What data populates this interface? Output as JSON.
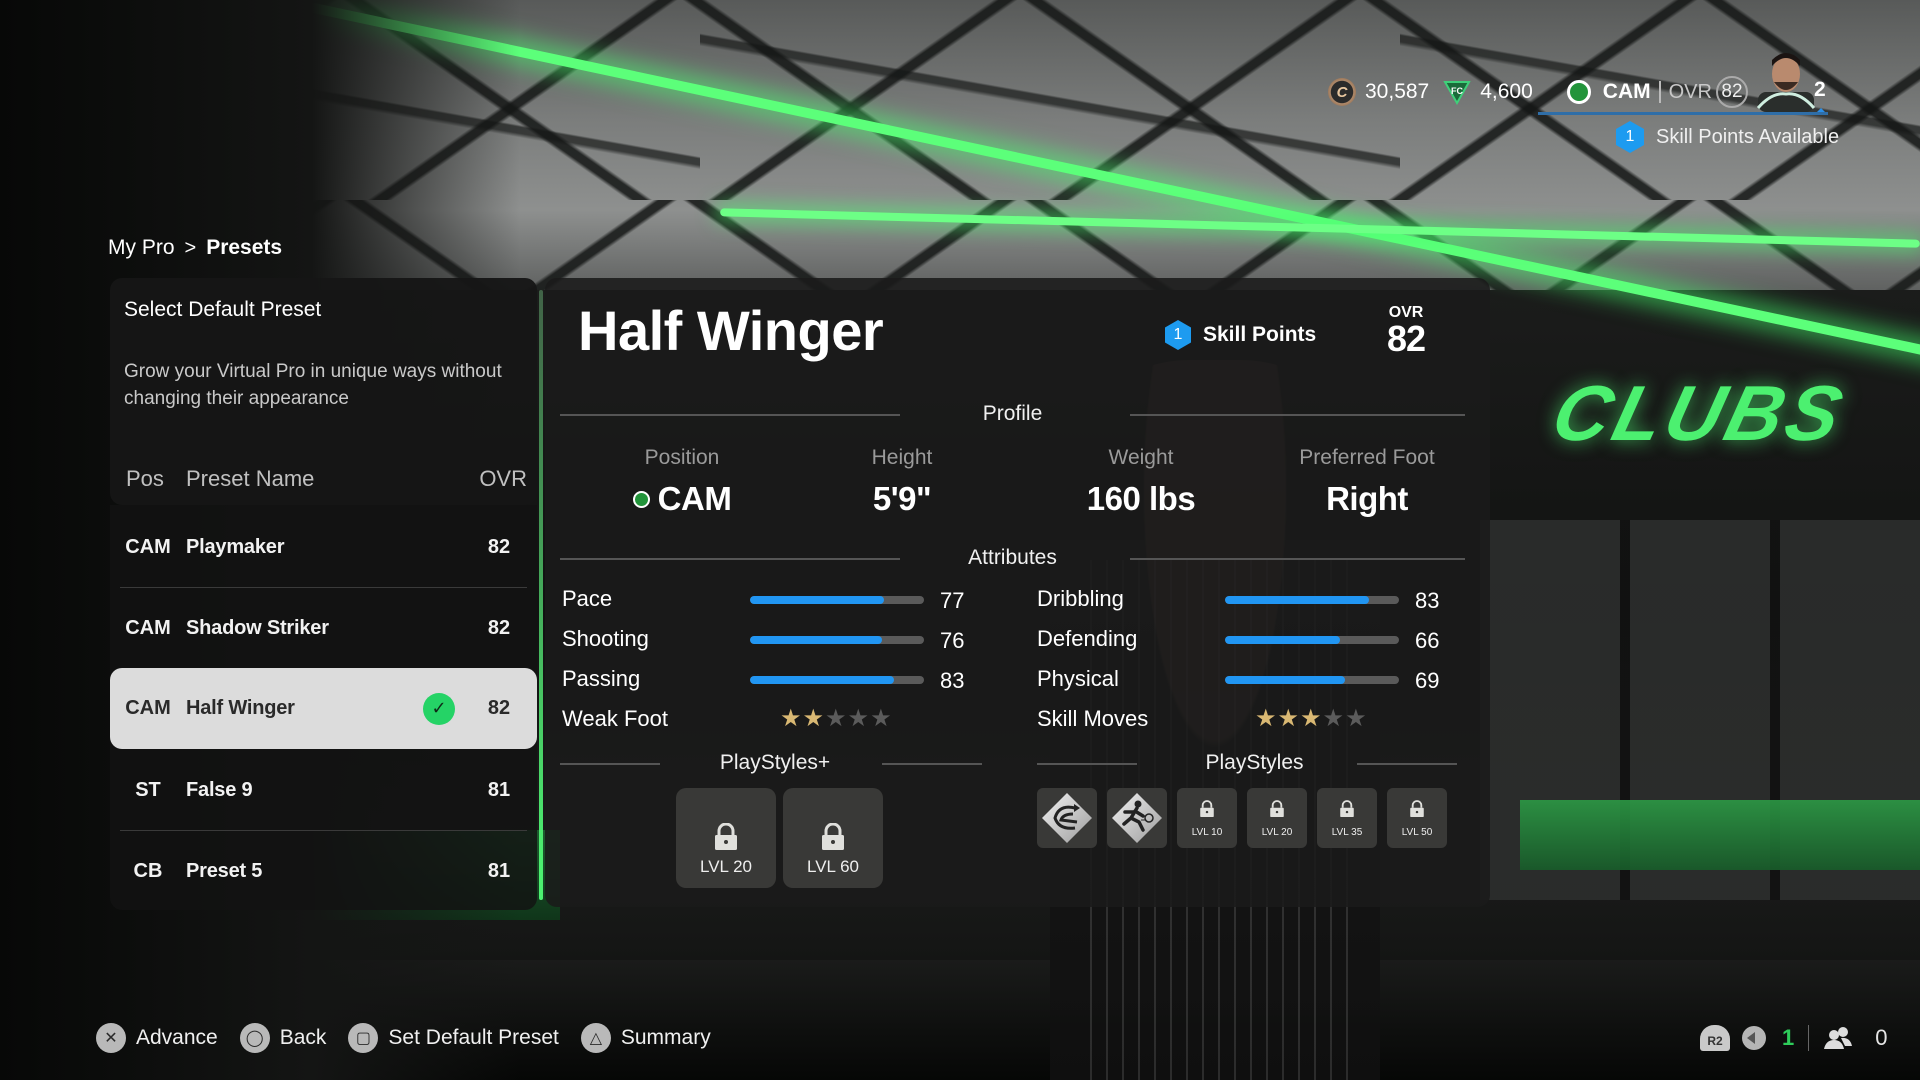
{
  "hud": {
    "coins": "30,587",
    "points": "4,600",
    "position": "CAM",
    "ovr_label": "OVR",
    "ovr": "82",
    "level": "2",
    "skill_points_count": "1",
    "skill_points_label": "Skill Points Available"
  },
  "breadcrumb": {
    "parent": "My Pro",
    "separator": ">",
    "current": "Presets"
  },
  "left_panel": {
    "title": "Select Default Preset",
    "description": "Grow your Virtual Pro in unique ways without changing their appearance",
    "columns": {
      "pos": "Pos",
      "name": "Preset Name",
      "ovr": "OVR"
    },
    "presets": [
      {
        "pos": "CAM",
        "name": "Playmaker",
        "ovr": "82",
        "selected": false
      },
      {
        "pos": "CAM",
        "name": "Shadow Striker",
        "ovr": "82",
        "selected": false
      },
      {
        "pos": "CAM",
        "name": "Half Winger",
        "ovr": "82",
        "selected": true,
        "default": true
      },
      {
        "pos": "ST",
        "name": "False 9",
        "ovr": "81",
        "selected": false
      },
      {
        "pos": "CB",
        "name": "Preset 5",
        "ovr": "81",
        "selected": false
      }
    ]
  },
  "detail": {
    "title": "Half Winger",
    "skill_points_count": "1",
    "skill_points_label": "Skill Points",
    "ovr_label": "OVR",
    "ovr": "82",
    "profile_label": "Profile",
    "profile": [
      {
        "label": "Position",
        "value": "CAM"
      },
      {
        "label": "Height",
        "value": "5'9\""
      },
      {
        "label": "Weight",
        "value": "160 lbs"
      },
      {
        "label": "Preferred Foot",
        "value": "Right"
      }
    ],
    "attributes_label": "Attributes",
    "attributes_left": [
      {
        "name": "Pace",
        "value": 77
      },
      {
        "name": "Shooting",
        "value": 76
      },
      {
        "name": "Passing",
        "value": 83
      }
    ],
    "attributes_right": [
      {
        "name": "Dribbling",
        "value": 83
      },
      {
        "name": "Defending",
        "value": 66
      },
      {
        "name": "Physical",
        "value": 69
      }
    ],
    "weak_foot": {
      "label": "Weak Foot",
      "stars": 2,
      "max": 5
    },
    "skill_moves": {
      "label": "Skill Moves",
      "stars": 3,
      "max": 5
    },
    "playstyles_plus_label": "PlayStyles+",
    "playstyles_plus": [
      {
        "locked": true,
        "level": "LVL 20"
      },
      {
        "locked": true,
        "level": "LVL 60"
      }
    ],
    "playstyles_label": "PlayStyles",
    "playstyles": [
      {
        "locked": false,
        "icon": "incisive-pass-icon"
      },
      {
        "locked": false,
        "icon": "power-shot-icon"
      },
      {
        "locked": true,
        "level": "LVL 10"
      },
      {
        "locked": true,
        "level": "LVL 20"
      },
      {
        "locked": true,
        "level": "LVL 35"
      },
      {
        "locked": true,
        "level": "LVL 50"
      }
    ]
  },
  "hints": [
    {
      "button": "cross",
      "glyph": "✕",
      "label": "Advance"
    },
    {
      "button": "circle",
      "glyph": "◯",
      "label": "Back"
    },
    {
      "button": "square",
      "glyph": "▢",
      "label": "Set Default Preset"
    },
    {
      "button": "triangle",
      "glyph": "△",
      "label": "Summary"
    }
  ],
  "status": {
    "r2_label": "R2",
    "voice_count": "1",
    "party_count": "0"
  },
  "colors": {
    "accent_green": "#25d366",
    "bar_blue": "#2196f3",
    "skill_blue": "#1d9bf0",
    "star_gold": "#d9b873"
  }
}
